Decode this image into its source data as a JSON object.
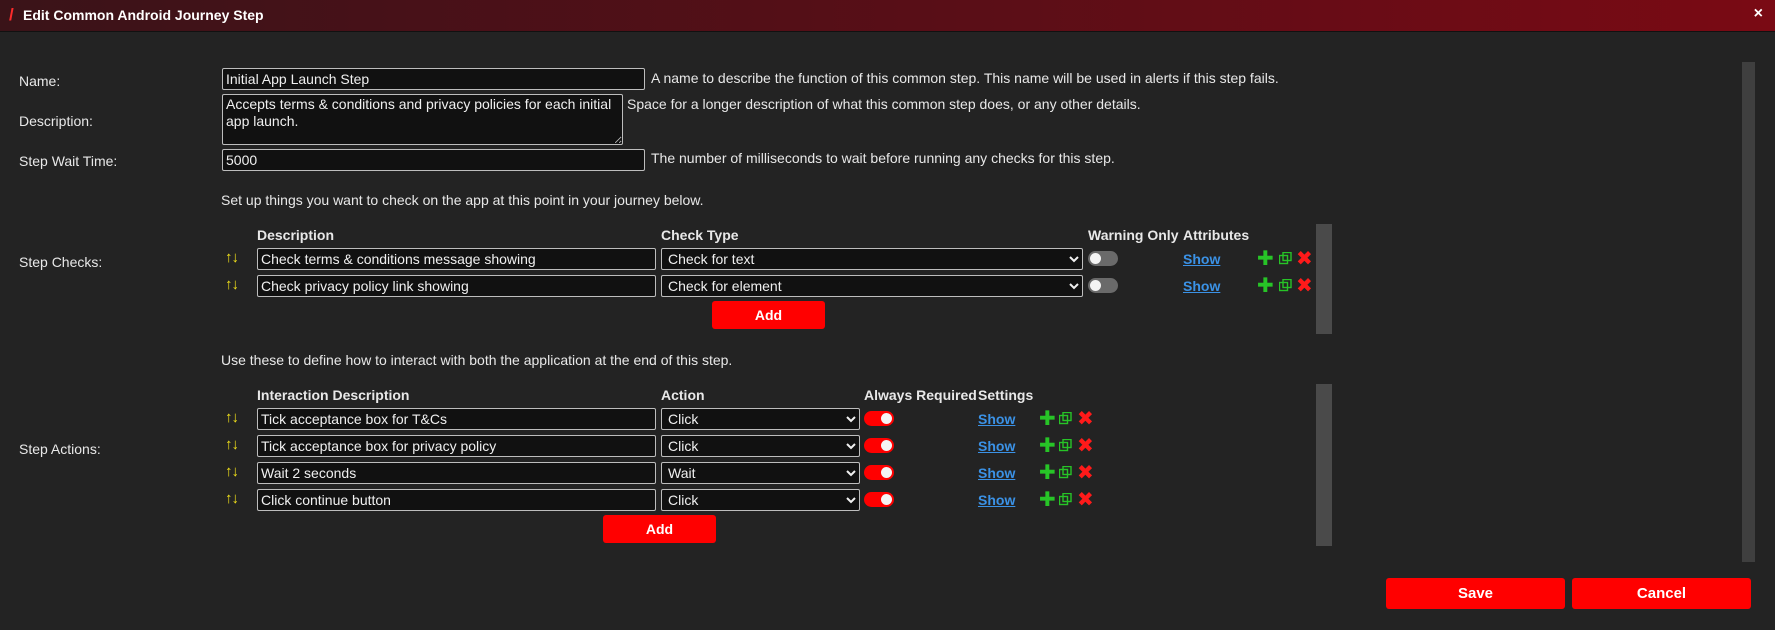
{
  "window": {
    "title": "Edit Common Android Journey Step",
    "close": "×"
  },
  "form": {
    "name_label": "Name:",
    "name_value": "Initial App Launch Step",
    "name_help": "A name to describe the function of this common step. This name will be used in alerts if this step fails.",
    "description_label": "Description:",
    "description_value": "Accepts terms & conditions and privacy policies for each initial app launch.",
    "description_help": "Space for a longer description of what this common step does, or any other details.",
    "wait_label": "Step Wait Time:",
    "wait_value": "5000",
    "wait_help": "The number of milliseconds to wait before running any checks for this step."
  },
  "checks": {
    "intro": "Set up things you want to check on the app at this point in your journey below.",
    "label": "Step Checks:",
    "headers": {
      "description": "Description",
      "type": "Check Type",
      "warning": "Warning Only",
      "attributes": "Attributes"
    },
    "rows": [
      {
        "description": "Check terms & conditions message showing",
        "type": "Check for text",
        "warning_only": false,
        "link": "Show"
      },
      {
        "description": "Check privacy policy link showing",
        "type": "Check for element",
        "warning_only": false,
        "link": "Show"
      }
    ],
    "add_label": "Add"
  },
  "actions": {
    "intro": "Use these to define how to interact with both the application at the end of this step.",
    "label": "Step Actions:",
    "headers": {
      "description": "Interaction Description",
      "action": "Action",
      "required": "Always Required",
      "settings": "Settings"
    },
    "rows": [
      {
        "description": "Tick acceptance box for T&Cs",
        "action": "Click",
        "always_required": true,
        "link": "Show"
      },
      {
        "description": "Tick acceptance box for privacy policy",
        "action": "Click",
        "always_required": true,
        "link": "Show"
      },
      {
        "description": "Wait 2 seconds",
        "action": "Wait",
        "always_required": true,
        "link": "Show"
      },
      {
        "description": "Click continue button",
        "action": "Click",
        "always_required": true,
        "link": "Show"
      }
    ],
    "add_label": "Add"
  },
  "footer": {
    "save": "Save",
    "cancel": "Cancel"
  },
  "colors": {
    "accent": "#ff0000",
    "link": "#3b92e6",
    "arrows": "#f2e21a",
    "add_icon": "#27c427"
  }
}
